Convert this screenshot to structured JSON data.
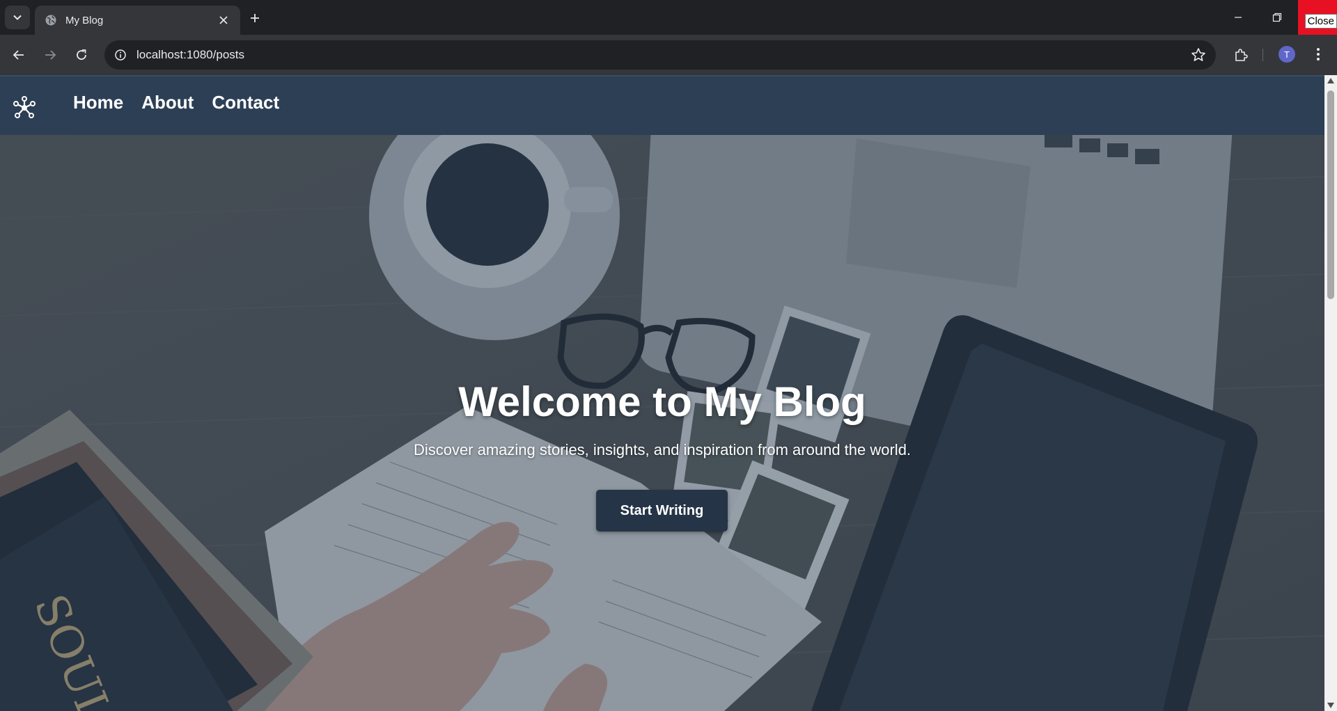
{
  "browser": {
    "tab_title": "My Blog",
    "url": "localhost:1080/posts",
    "close_tooltip": "Close",
    "profile_initial": "T",
    "colors": {
      "chrome_bg": "#202124",
      "toolbar_bg": "#35363a",
      "close_red": "#e81123",
      "avatar": "#5f67c9"
    },
    "icons": [
      "tab-search-icon",
      "globe-icon",
      "close-icon",
      "plus-icon",
      "minimize-icon",
      "restore-icon",
      "back-icon",
      "forward-icon",
      "reload-icon",
      "info-icon",
      "star-icon",
      "extensions-icon",
      "more-vert-icon"
    ]
  },
  "site": {
    "nav": {
      "links": [
        "Home",
        "About",
        "Contact"
      ],
      "logo_icon": "network-hub-icon"
    },
    "hero": {
      "title": "Welcome to My Blog",
      "subtitle": "Discover amazing stories, insights, and inspiration from around the world.",
      "cta_label": "Start Writing"
    },
    "colors": {
      "nav_bg": "#2d3f55",
      "cta_bg": "#253446",
      "text": "#ffffff"
    }
  }
}
